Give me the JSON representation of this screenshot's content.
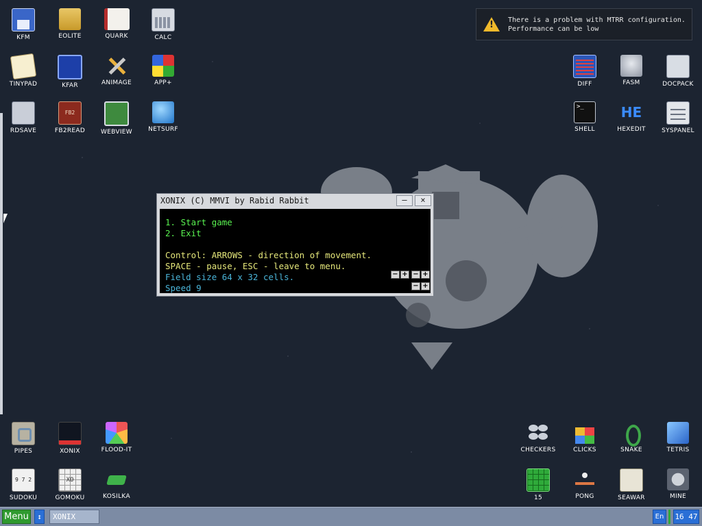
{
  "desktop": {
    "icons": [
      {
        "label": "KFM",
        "icon": "floppy-disk-icon"
      },
      {
        "label": "EOLITE",
        "icon": "folder-icon"
      },
      {
        "label": "QUARK",
        "icon": "notebook-icon"
      },
      {
        "label": "CALC",
        "icon": "calculator-icon"
      },
      {
        "label": "TINYPAD",
        "icon": "notepad-icon"
      },
      {
        "label": "KFAR",
        "icon": "file-manager-icon"
      },
      {
        "label": "ANIMAGE",
        "icon": "pencil-ruler-icon"
      },
      {
        "label": "APP+",
        "icon": "rubik-cube-icon"
      },
      {
        "label": "RDSAVE",
        "icon": "ramdisk-save-icon"
      },
      {
        "label": "FB2READ",
        "icon": "fb2-book-icon"
      },
      {
        "label": "WEBVIEW",
        "icon": "web-browser-icon"
      },
      {
        "label": "NETSURF",
        "icon": "globe-icon"
      },
      {
        "label": "DIFF",
        "icon": "diff-icon"
      },
      {
        "label": "FASM",
        "icon": "fasm-icon"
      },
      {
        "label": "DOCPACK",
        "icon": "cabinet-icon"
      },
      {
        "label": "SHELL",
        "icon": "terminal-icon"
      },
      {
        "label": "HEXEDIT",
        "icon": "hex-editor-icon"
      },
      {
        "label": "SYSPANEL",
        "icon": "control-panel-icon"
      },
      {
        "label": "PIPES",
        "icon": "pipes-icon"
      },
      {
        "label": "XONIX",
        "icon": "xonix-icon"
      },
      {
        "label": "FLOOD-IT",
        "icon": "color-grid-icon"
      },
      {
        "label": "SUDOKU",
        "icon": "sudoku-icon"
      },
      {
        "label": "GOMOKU",
        "icon": "gomoku-board-icon"
      },
      {
        "label": "KOSILKA",
        "icon": "lawn-mower-icon"
      },
      {
        "label": "CHECKERS",
        "icon": "checkers-icon"
      },
      {
        "label": "CLICKS",
        "icon": "blocks-icon"
      },
      {
        "label": "SNAKE",
        "icon": "snake-icon"
      },
      {
        "label": "TETRIS",
        "icon": "tetris-icon"
      },
      {
        "label": "15",
        "icon": "fifteen-puzzle-icon"
      },
      {
        "label": "PONG",
        "icon": "pong-icon"
      },
      {
        "label": "SEAWAR",
        "icon": "sea-battle-icon"
      },
      {
        "label": "MINE",
        "icon": "mine-icon"
      }
    ],
    "fb2_badge": "FB2",
    "he_logo": "HE",
    "shell_prompt": ">_",
    "sudoku_digits": "9 7 2",
    "gomoku_marks": "XO"
  },
  "notification": {
    "icon": "warning-icon",
    "line1": "There is a problem with MTRR configuration.",
    "line2": "Performance can be low"
  },
  "xonix_window": {
    "title": "XONIX (C) MMVI by Rabid Rabbit",
    "minimize_label": "–",
    "close_label": "×",
    "menu": [
      "1. Start game",
      "2. Exit"
    ],
    "control_line1": "Control: ARROWS - direction of movement.",
    "control_line2": "SPACE - pause, ESC - leave to menu.",
    "field_size": "Field size 64 x 32 cells.",
    "speed": "Speed 9",
    "minus": "−",
    "plus": "+"
  },
  "taskbar": {
    "menu_label": "Menu",
    "switch_icon": "↕",
    "task_label": "XONIX",
    "lang": "En",
    "clock": "16 47"
  },
  "colors": {
    "desktop_bg": "#1c2431",
    "menu_green": "#2f9a2f",
    "taskbar": "#7c8ba4",
    "text_green": "#59f250",
    "text_yellow": "#e4e67a",
    "text_cyan": "#4ab4d8",
    "warning": "#f0b92b"
  }
}
